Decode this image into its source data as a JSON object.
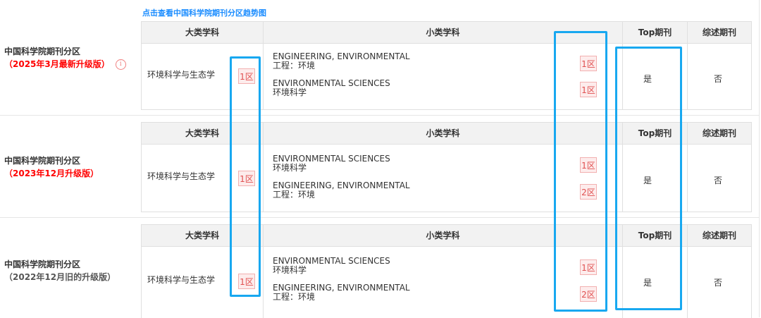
{
  "trend_link": "点击查看中国科学院期刊分区趋势图",
  "headers": {
    "major": "大类学科",
    "minor": "小类学科",
    "top": "Top期刊",
    "review": "综述期刊"
  },
  "sections": [
    {
      "title": "中国科学院期刊分区",
      "version": "（2025年3月最新升级版）",
      "major_subject": "环境科学与生态学",
      "major_zone": "1区",
      "subs": [
        {
          "en": "ENGINEERING, ENVIRONMENTAL",
          "zh": "工程：环境",
          "zone": "1区"
        },
        {
          "en": "ENVIRONMENTAL SCIENCES",
          "zh": "环境科学",
          "zone": "1区"
        }
      ],
      "top": "是",
      "review": "否"
    },
    {
      "title": "中国科学院期刊分区",
      "version": "（2023年12月升级版）",
      "major_subject": "环境科学与生态学",
      "major_zone": "1区",
      "subs": [
        {
          "en": "ENVIRONMENTAL SCIENCES",
          "zh": "环境科学",
          "zone": "1区"
        },
        {
          "en": "ENGINEERING, ENVIRONMENTAL",
          "zh": "工程：环境",
          "zone": "2区"
        }
      ],
      "top": "是",
      "review": "否"
    },
    {
      "title": "中国科学院期刊分区",
      "version": "（2022年12月旧的升级版）",
      "major_subject": "环境科学与生态学",
      "major_zone": "1区",
      "subs": [
        {
          "en": "ENVIRONMENTAL SCIENCES",
          "zh": "环境科学",
          "zone": "1区"
        },
        {
          "en": "ENGINEERING, ENVIRONMENTAL",
          "zh": "工程：环境",
          "zone": "2区"
        }
      ],
      "top": "是",
      "review": "否"
    }
  ],
  "colors": {
    "highlight": "#18a8f0",
    "zone_text": "#e05050",
    "latest_version": "#ff0000",
    "link": "#1a8cff"
  }
}
